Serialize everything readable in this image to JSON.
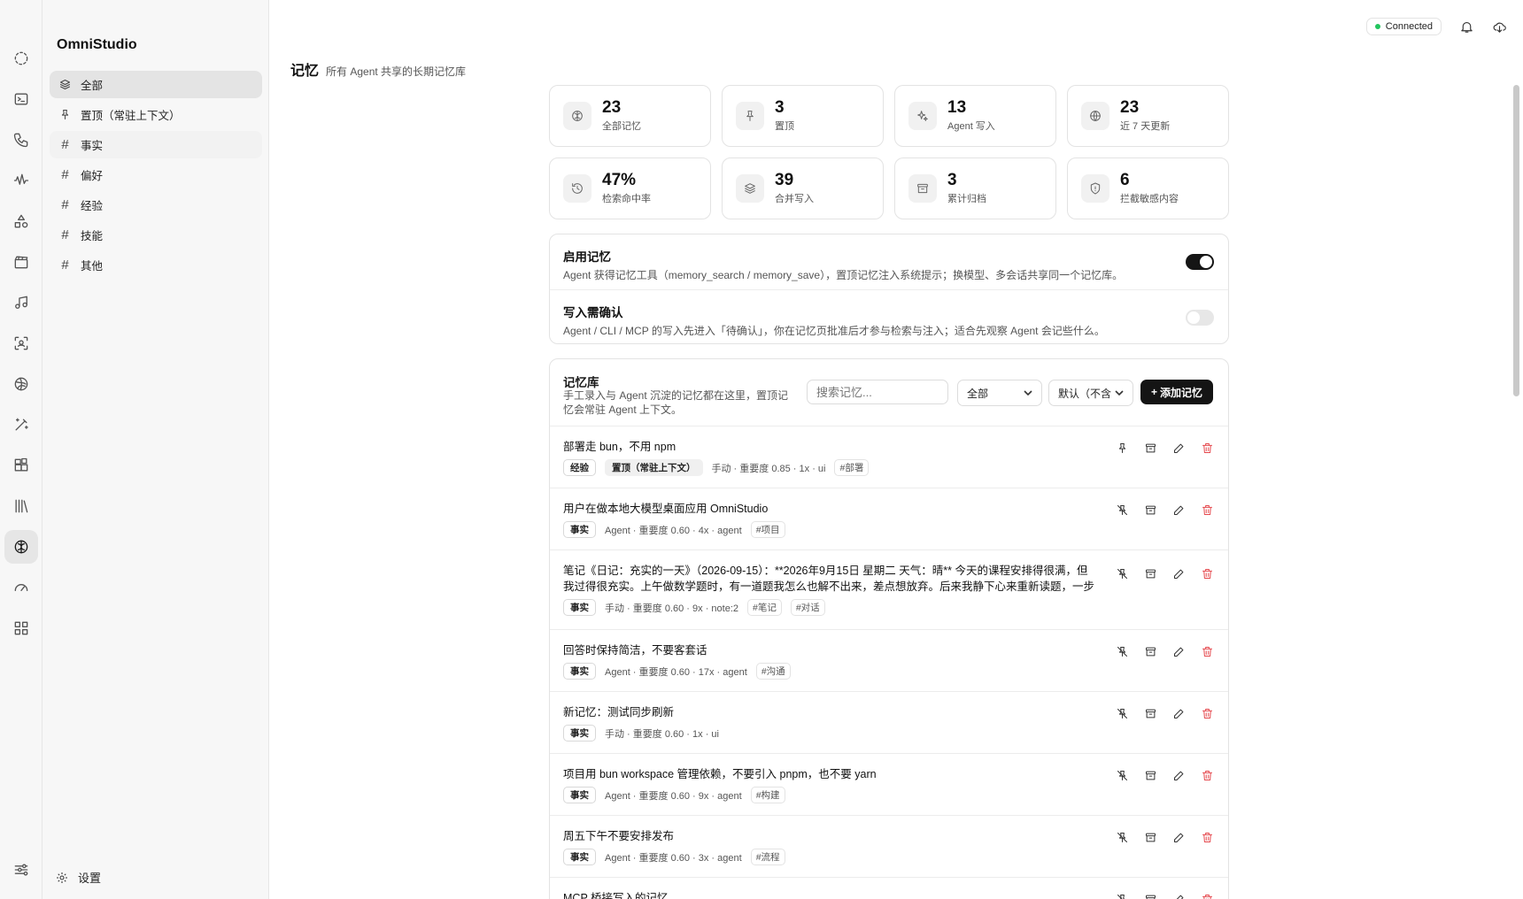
{
  "app": {
    "name": "OmniStudio"
  },
  "sidebar": {
    "items": [
      {
        "label": "全部"
      },
      {
        "label": "置顶（常驻上下文）"
      },
      {
        "label": "事实"
      },
      {
        "label": "偏好"
      },
      {
        "label": "经验"
      },
      {
        "label": "技能"
      },
      {
        "label": "其他"
      }
    ],
    "settings_label": "设置"
  },
  "topbar": {
    "status": "Connected"
  },
  "page": {
    "title": "记忆",
    "subtitle": "所有 Agent 共享的长期记忆库"
  },
  "stats": [
    {
      "value": "23",
      "label": "全部记忆",
      "icon": "brain-icon"
    },
    {
      "value": "3",
      "label": "置顶",
      "icon": "pin-icon"
    },
    {
      "value": "13",
      "label": "Agent 写入",
      "icon": "sparkles-icon"
    },
    {
      "value": "23",
      "label": "近 7 天更新",
      "icon": "globe-icon"
    },
    {
      "value": "47%",
      "label": "检索命中率",
      "icon": "history-icon"
    },
    {
      "value": "39",
      "label": "合并写入",
      "icon": "layers-icon"
    },
    {
      "value": "3",
      "label": "累计归档",
      "icon": "archive-icon"
    },
    {
      "value": "6",
      "label": "拦截敏感内容",
      "icon": "shield-icon"
    }
  ],
  "settings": {
    "enable": {
      "title": "启用记忆",
      "desc": "Agent 获得记忆工具（memory_search / memory_save），置顶记忆注入系统提示；换模型、多会话共享同一个记忆库。",
      "on": true
    },
    "confirm": {
      "title": "写入需确认",
      "desc": "Agent / CLI / MCP 的写入先进入「待确认」，你在记忆页批准后才参与检索与注入；适合先观察 Agent 会记些什么。",
      "on": false
    }
  },
  "library": {
    "title": "记忆库",
    "desc": "手工录入与 Agent 沉淀的记忆都在这里，置顶记忆会常驻 Agent 上下文。",
    "search_placeholder": "搜索记忆...",
    "filter_value": "全部",
    "sort_value": "默认（不含",
    "add_label": "添加记忆",
    "items": [
      {
        "text": "部署走 bun，不用 npm",
        "tags": [
          "经验",
          "置顶（常驻上下文）"
        ],
        "meta": "手动 · 重要度 0.85 · 1x · ui",
        "hashtags": [
          "#部署"
        ],
        "pinned": true
      },
      {
        "text": "用户在做本地大模型桌面应用 OmniStudio",
        "tags": [
          "事实"
        ],
        "meta": "Agent · 重要度 0.60 · 4x · agent",
        "hashtags": [
          "#项目"
        ],
        "pinned": false
      },
      {
        "text": "笔记《日记：充实的一天》（2026-09-15）：**2026年9月15日 星期二 天气：晴** 今天的课程安排得很满，但我过得很充实。上午做数学题时，有一道题我怎么也解不出来，差点想放弃。后来我静下心来重新读题，一步步…",
        "tags": [
          "事实"
        ],
        "meta": "手动 · 重要度 0.60 · 9x · note:2",
        "hashtags": [
          "#笔记",
          "#对话"
        ],
        "pinned": false
      },
      {
        "text": "回答时保持简洁，不要客套话",
        "tags": [
          "事实"
        ],
        "meta": "Agent · 重要度 0.60 · 17x · agent",
        "hashtags": [
          "#沟通"
        ],
        "pinned": false
      },
      {
        "text": "新记忆：测试同步刷新",
        "tags": [
          "事实"
        ],
        "meta": "手动 · 重要度 0.60 · 1x · ui",
        "hashtags": [],
        "pinned": false
      },
      {
        "text": "项目用 bun workspace 管理依赖，不要引入 pnpm，也不要 yarn",
        "tags": [
          "事实"
        ],
        "meta": "Agent · 重要度 0.60 · 9x · agent",
        "hashtags": [
          "#构建"
        ],
        "pinned": false
      },
      {
        "text": "周五下午不要安排发布",
        "tags": [
          "事实"
        ],
        "meta": "Agent · 重要度 0.60 · 3x · agent",
        "hashtags": [
          "#流程"
        ],
        "pinned": false
      },
      {
        "text": "MCP 桥接写入的记忆",
        "tags": [],
        "meta": "",
        "hashtags": [],
        "pinned": false
      }
    ]
  }
}
